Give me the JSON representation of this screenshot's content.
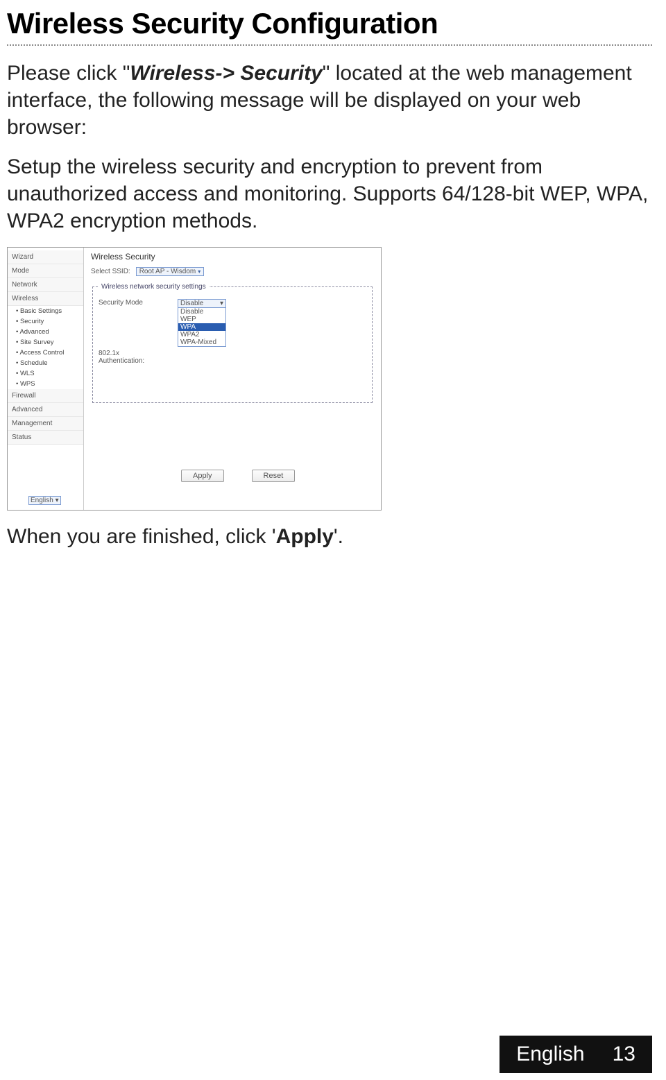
{
  "heading": "Wireless Security Configuration",
  "intro": {
    "pre": "Please click \"",
    "nav": "Wireless-> Security",
    "post": "\" located at the web management interface, the following message will be displayed on your web browser:"
  },
  "desc": "Setup the wireless security and encryption to prevent from unauthorized access and monitoring. Supports 64/128-bit WEP, WPA, WPA2 encryption methods.",
  "closing": {
    "pre": "When you are finished, click '",
    "btn": "Apply",
    "post": "'."
  },
  "shot": {
    "sidebar": {
      "items": [
        "Wizard",
        "Mode",
        "Network"
      ],
      "wireless_label": "Wireless",
      "wireless_sub": [
        "• Basic Settings",
        "• Security",
        "• Advanced",
        "• Site Survey",
        "• Access Control",
        "• Schedule",
        "• WLS",
        "• WPS"
      ],
      "items_bottom": [
        "Firewall",
        "Advanced",
        "Management",
        "Status"
      ]
    },
    "main": {
      "title": "Wireless Security",
      "ssid_label": "Select SSID:",
      "ssid_value": "Root AP - Wisdom",
      "group_legend": "Wireless network security settings",
      "secmode_label": "Security Mode",
      "auth_label": "802.1x Authentication:",
      "dropdown": {
        "selected": "Disable",
        "opts": [
          "Disable",
          "WEP",
          "WPA",
          "WPA2",
          "WPA-Mixed"
        ],
        "highlight_index": 2
      },
      "apply": "Apply",
      "reset": "Reset"
    },
    "lang": "English"
  },
  "footer": {
    "lang": "English",
    "page": "13"
  }
}
